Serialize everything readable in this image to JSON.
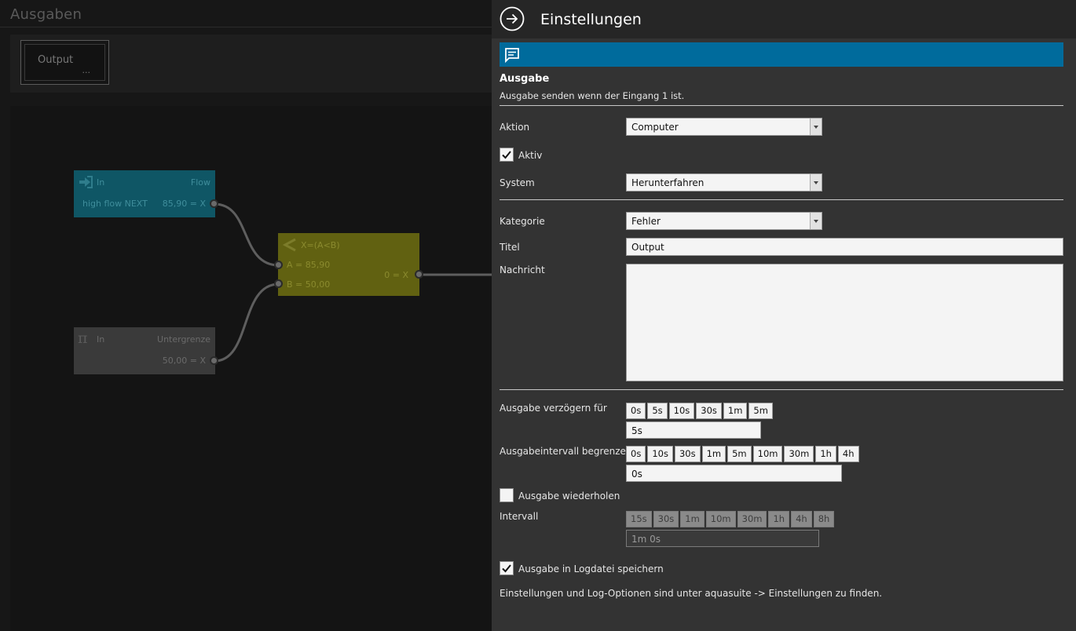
{
  "left": {
    "title": "Ausgaben",
    "output_tile": {
      "label": "Output",
      "more": "..."
    },
    "nodes": {
      "flow": {
        "kind": "In",
        "name": "Flow",
        "source": "high flow NEXT",
        "value": "85,90 = X"
      },
      "compare": {
        "formula": "X=(A<B)",
        "input_a": "A = 85,90",
        "input_b": "B = 50,00",
        "output": "0 = X"
      },
      "lower": {
        "kind": "In",
        "name": "Untergrenze",
        "value": "50,00 = X"
      }
    }
  },
  "panel": {
    "title": "Einstellungen",
    "section_title": "Ausgabe",
    "section_desc": "Ausgabe senden wenn der Eingang 1 ist.",
    "aktion": {
      "label": "Aktion",
      "value": "Computer"
    },
    "aktiv": {
      "label": "Aktiv",
      "checked": true
    },
    "system": {
      "label": "System",
      "value": "Herunterfahren"
    },
    "kategorie": {
      "label": "Kategorie",
      "value": "Fehler"
    },
    "titel": {
      "label": "Titel",
      "value": "Output"
    },
    "nachricht": {
      "label": "Nachricht",
      "value": ""
    },
    "delay": {
      "label": "Ausgabe verzögern für",
      "buttons": [
        "0s",
        "5s",
        "10s",
        "30s",
        "1m",
        "5m"
      ],
      "value": "5s"
    },
    "limit": {
      "label": "Ausgabeintervall begrenzen",
      "buttons": [
        "0s",
        "10s",
        "30s",
        "1m",
        "5m",
        "10m",
        "30m",
        "1h",
        "4h"
      ],
      "value": "0s"
    },
    "repeat": {
      "label": "Ausgabe wiederholen",
      "checked": false
    },
    "intervall": {
      "label": "Intervall",
      "buttons": [
        "15s",
        "30s",
        "1m",
        "10m",
        "30m",
        "1h",
        "4h",
        "8h"
      ],
      "value": "1m 0s"
    },
    "log": {
      "label": "Ausgabe in Logdatei speichern",
      "checked": true
    },
    "footer": "Einstellungen und Log-Optionen sind unter aquasuite -> Einstellungen zu finden."
  },
  "colors": {
    "accent": "#006b9c",
    "panel_bg": "#333333",
    "flow_node": "#0f5665",
    "compare_node": "#616111"
  }
}
